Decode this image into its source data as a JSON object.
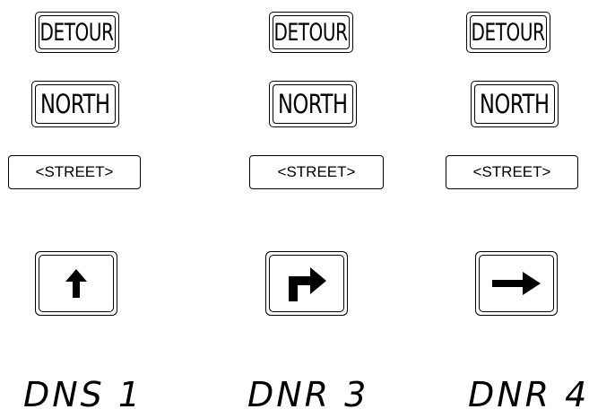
{
  "signs": [
    {
      "detour": "DETOUR",
      "direction": "NORTH",
      "street": "<STREET>",
      "arrow_icon": "up-arrow-icon",
      "label": "DNS 1"
    },
    {
      "detour": "DETOUR",
      "direction": "NORTH",
      "street": "<STREET>",
      "arrow_icon": "turn-right-arrow-icon",
      "label": "DNR 3"
    },
    {
      "detour": "DETOUR",
      "direction": "NORTH",
      "street": "<STREET>",
      "arrow_icon": "right-arrow-icon",
      "label": "DNR 4"
    }
  ]
}
